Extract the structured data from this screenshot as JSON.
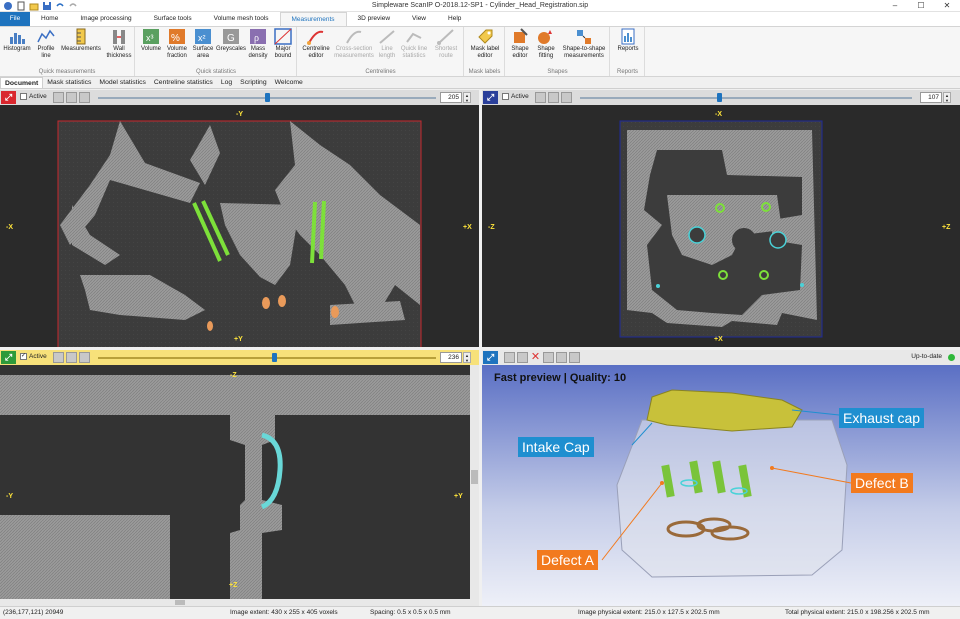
{
  "window": {
    "title": "Simpleware ScanIP O-2018.12-SP1 - Cylinder_Head_Registration.sip"
  },
  "menu": {
    "tabs": [
      "File",
      "Home",
      "Image processing",
      "Surface tools",
      "Volume mesh tools",
      "Measurements",
      "3D preview",
      "View",
      "Help"
    ],
    "active": "Measurements"
  },
  "ribbon": {
    "groups": [
      {
        "label": "Quick measurements",
        "buttons": [
          "Histogram",
          "Profile line",
          "Measurements",
          "Wall thickness"
        ]
      },
      {
        "label": "Quick statistics",
        "buttons": [
          "Volume",
          "Volume fraction",
          "Surface area",
          "Greyscales",
          "Mass density",
          "Major bound"
        ]
      },
      {
        "label": "Centrelines",
        "buttons": [
          "Centreline editor",
          "Cross-section measurements",
          "Line length",
          "Quick line statistics",
          "Shortest route"
        ]
      },
      {
        "label": "Mask labels",
        "buttons": [
          "Mask label editor"
        ]
      },
      {
        "label": "Shapes",
        "buttons": [
          "Shape editor",
          "Shape fitting",
          "Shape-to-shape measurements"
        ]
      },
      {
        "label": "Reports",
        "buttons": [
          "Reports"
        ]
      }
    ]
  },
  "doc_tabs": [
    "Document",
    "Mask statistics",
    "Model statistics",
    "Centreline statistics",
    "Log",
    "Scripting",
    "Welcome"
  ],
  "views": {
    "top_left": {
      "active_label": "Active",
      "slice": "205",
      "axis_top": "-Y",
      "axis_bottom": "+Y",
      "axis_left": "-X",
      "axis_right": "+X",
      "badge_color": "#d9272e",
      "border_color": "#c8282e",
      "slider_value": 0.5
    },
    "top_right": {
      "active_label": "Active",
      "slice": "107",
      "axis_top": "-X",
      "axis_bottom": "+X",
      "axis_left": "-Z",
      "axis_right": "+Z",
      "badge_color": "#2a3f9a",
      "border_color": "#1e2a9a",
      "slider_value": 0.42
    },
    "bottom_left": {
      "active_label": "Active",
      "slice": "236",
      "axis_top": "-Z",
      "axis_bottom": "+Z",
      "axis_left": "-Y",
      "axis_right": "+Y",
      "badge_color": "#2e9a3a",
      "slider_value": 0.52
    },
    "preview_3d": {
      "status": "Up-to-date",
      "status_color": "#2eb83a",
      "preview_label": "Fast preview | Quality: 10"
    }
  },
  "callouts": [
    {
      "text": "Exhaust cap",
      "color": "#1f8fd0"
    },
    {
      "text": "Intake Cap",
      "color": "#1f8fd0"
    },
    {
      "text": "Defect B",
      "color": "#f27a1e"
    },
    {
      "text": "Defect A",
      "color": "#f27a1e"
    }
  ],
  "status": {
    "cursor": "(236,177,121) 20949",
    "image_extent": "Image extent: 430 x 255 x 405 voxels",
    "spacing": "Spacing: 0.5 x 0.5 x 0.5 mm",
    "physical_extent": "Image physical extent: 215.0 x 127.5 x 202.5 mm",
    "total_extent": "Total physical extent: 215.0 x 198.256 x 202.5 mm"
  }
}
